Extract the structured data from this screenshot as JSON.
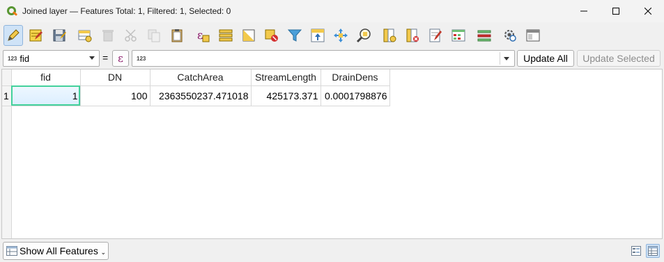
{
  "window": {
    "title": "Joined layer — Features Total: 1, Filtered: 1, Selected: 0",
    "controls": [
      "minimize",
      "maximize",
      "close"
    ]
  },
  "toolbar": {
    "icons": [
      "toggle-editing-icon",
      "multi-edit-icon",
      "save-edits-icon",
      "add-feature-icon",
      "delete-selected-icon",
      "cut-icon",
      "copy-icon",
      "paste-icon",
      "select-by-expression-icon",
      "select-all-icon",
      "invert-selection-icon",
      "deselect-all-icon",
      "filter-icon",
      "move-selection-to-top-icon",
      "pan-to-selected-icon",
      "zoom-to-selected-icon",
      "new-field-icon",
      "delete-field-icon",
      "field-calculator-icon",
      "conditional-formatting-icon",
      "dock-table-icon",
      "actions-icon",
      "dock-window-icon"
    ]
  },
  "filter": {
    "field_type": "123",
    "field_value": "fid",
    "equals": "=",
    "epsilon": "ε",
    "expression_type": "123",
    "expression_value": "",
    "update_all": "Update All",
    "update_selected": "Update Selected"
  },
  "table": {
    "columns": [
      "fid",
      "DN",
      "CatchArea",
      "StreamLength",
      "DrainDens"
    ],
    "rows": [
      {
        "row_number": "1",
        "fid": "1",
        "DN": "100",
        "CatchArea": "2363550237.471018",
        "StreamLength": "425173.371",
        "DrainDens": "0.0001798876"
      }
    ]
  },
  "bottom": {
    "show_all": "Show All Features",
    "dropdown_marker": "⌄"
  },
  "colors": {
    "selection_outline": "#43d19c",
    "active_button_bg": "#cfe3f7",
    "qgis_green": "#589632"
  }
}
